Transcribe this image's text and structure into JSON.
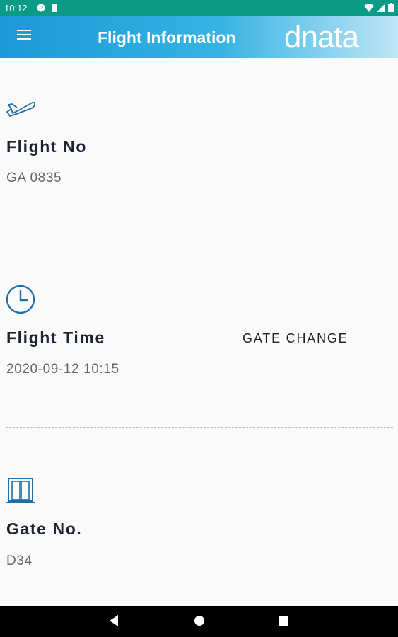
{
  "status_bar": {
    "time": "10:12"
  },
  "app_bar": {
    "title": "Flight Information",
    "logo_text": "dnata",
    "accent": "#1a9ad6"
  },
  "flight": {
    "label": "Flight No",
    "value": "GA 0835"
  },
  "time": {
    "label": "Flight Time",
    "value": "2020-09-12 10:15",
    "gate_change": "GATE CHANGE"
  },
  "gate": {
    "label": "Gate No.",
    "value": "D34"
  },
  "icons": {
    "flight": "airplane-icon",
    "time": "clock-icon",
    "gate": "gate-door-icon"
  }
}
